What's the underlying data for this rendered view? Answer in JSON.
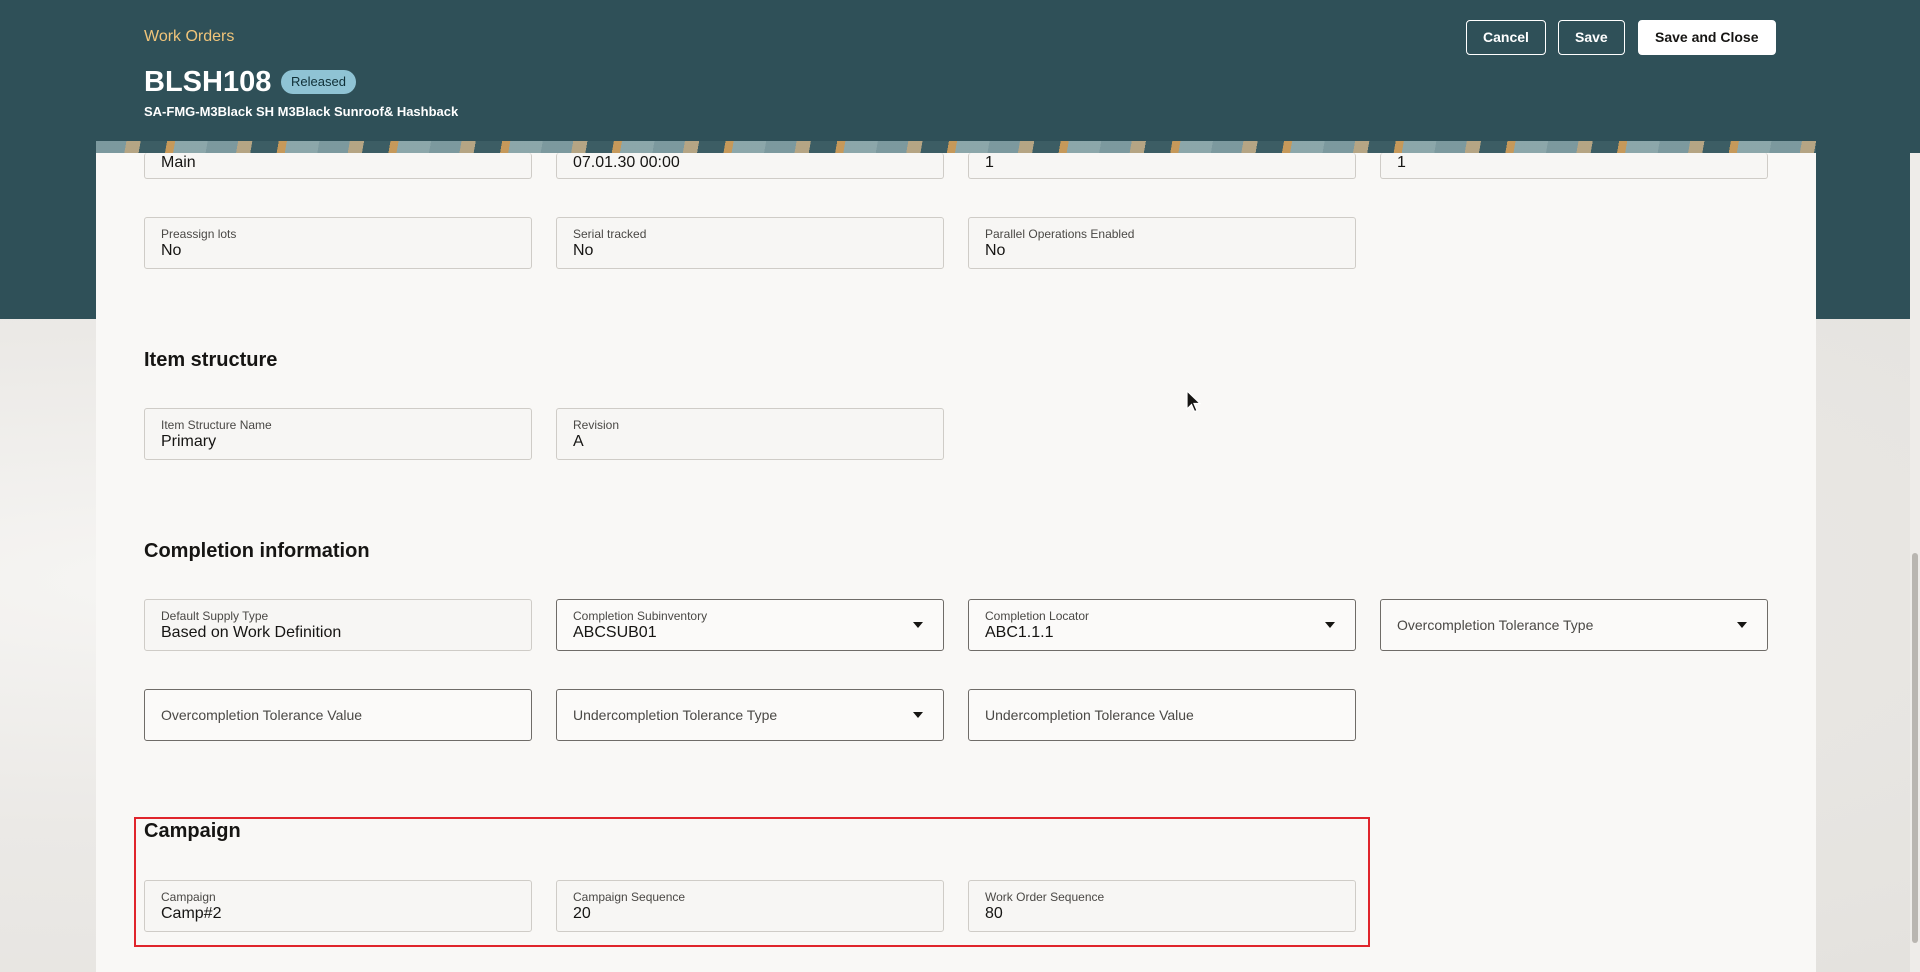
{
  "header": {
    "breadcrumb": "Work Orders",
    "title": "BLSH108",
    "status": "Released",
    "subtitle": "SA-FMG-M3Black SH M3Black Sunroof& Hashback",
    "buttons": {
      "cancel": "Cancel",
      "save": "Save",
      "save_close": "Save and Close"
    }
  },
  "top_row": {
    "col1": "Main",
    "col2": "07.01.30 00:00",
    "col3": "1",
    "col4": "1"
  },
  "general": {
    "preassign_lots": {
      "label": "Preassign lots",
      "value": "No"
    },
    "serial_tracked": {
      "label": "Serial tracked",
      "value": "No"
    },
    "parallel_ops": {
      "label": "Parallel Operations Enabled",
      "value": "No"
    }
  },
  "item_structure": {
    "heading": "Item structure",
    "name": {
      "label": "Item Structure Name",
      "value": "Primary"
    },
    "revision": {
      "label": "Revision",
      "value": "A"
    }
  },
  "completion": {
    "heading": "Completion information",
    "supply_type": {
      "label": "Default Supply Type",
      "value": "Based on Work Definition"
    },
    "subinventory": {
      "label": "Completion Subinventory",
      "value": "ABCSUB01"
    },
    "locator": {
      "label": "Completion Locator",
      "value": "ABC1.1.1"
    },
    "overcompletion_type": {
      "placeholder": "Overcompletion Tolerance Type"
    },
    "overcompletion_value": {
      "placeholder": "Overcompletion Tolerance Value"
    },
    "undercompletion_type": {
      "placeholder": "Undercompletion Tolerance Type"
    },
    "undercompletion_value": {
      "placeholder": "Undercompletion Tolerance Value"
    }
  },
  "campaign": {
    "heading": "Campaign",
    "campaign": {
      "label": "Campaign",
      "value": "Camp#2"
    },
    "campaign_sequence": {
      "label": "Campaign Sequence",
      "value": "20"
    },
    "work_order_sequence": {
      "label": "Work Order Sequence",
      "value": "80"
    }
  },
  "colors": {
    "header_bg": "#2f5058",
    "breadcrumb": "#f0c47a",
    "badge": "#8fc3d4",
    "highlight": "#e0252c"
  }
}
